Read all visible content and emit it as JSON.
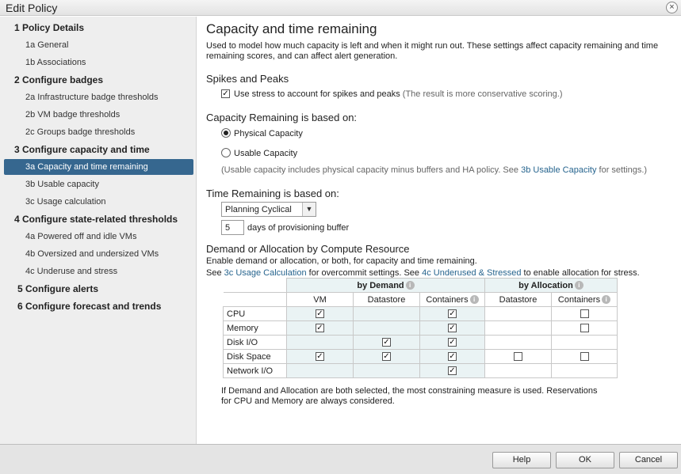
{
  "window": {
    "title": "Edit Policy",
    "close_glyph": "×"
  },
  "sidebar": {
    "items": [
      {
        "label": "1 Policy Details",
        "level": "h"
      },
      {
        "label": "1a General",
        "level": "s"
      },
      {
        "label": "1b Associations",
        "level": "s"
      },
      {
        "label": "2 Configure badges",
        "level": "h"
      },
      {
        "label": "2a Infrastructure badge thresholds",
        "level": "s"
      },
      {
        "label": "2b VM badge thresholds",
        "level": "s"
      },
      {
        "label": "2c Groups badge thresholds",
        "level": "s"
      },
      {
        "label": "3 Configure capacity and time",
        "level": "h"
      },
      {
        "label": "3a Capacity and time remaining",
        "level": "s",
        "selected": true
      },
      {
        "label": "3b Usable capacity",
        "level": "s"
      },
      {
        "label": "3c Usage calculation",
        "level": "s"
      },
      {
        "label": "4 Configure state-related thresholds",
        "level": "h"
      },
      {
        "label": "4a Powered off and idle VMs",
        "level": "s"
      },
      {
        "label": "4b Oversized and undersized VMs",
        "level": "s"
      },
      {
        "label": "4c Underuse and stress",
        "level": "s"
      },
      {
        "label": "5 Configure alerts",
        "level": "h"
      },
      {
        "label": "6 Configure forecast and trends",
        "level": "h"
      }
    ]
  },
  "main": {
    "title": "Capacity and time remaining",
    "intro_line1": "Used to model how much capacity is left and when it might run out. These settings affect capacity remaining and time",
    "intro_line2": "remaining scores, and can affect alert generation.",
    "spikes": {
      "heading": "Spikes and Peaks",
      "checkbox_label": "Use stress to account for spikes and peaks",
      "checked": true,
      "note": "(The result is more conservative scoring.)"
    },
    "capacity": {
      "heading": "Capacity Remaining is based on:",
      "option_physical": "Physical Capacity",
      "option_usable": "Usable Capacity",
      "selected": "Physical Capacity",
      "note_prefix": "(Usable capacity includes physical capacity minus buffers and HA policy. See",
      "note_link": "3b Usable Capacity",
      "note_suffix": "for settings.)"
    },
    "time": {
      "heading": "Time Remaining is based on:",
      "select_value": "Planning Cyclical",
      "days_value": "5",
      "days_label": "days of provisioning buffer"
    },
    "demand": {
      "heading": "Demand or Allocation by Compute Resource",
      "desc": "Enable demand or allocation, or both, for capacity and time remaining.",
      "see": "See",
      "link1": "3c Usage Calculation",
      "mid": "for overcommit settings. See",
      "link2": "4c Underused & Stressed",
      "end": "to enable allocation for stress.",
      "group_demand": "by Demand",
      "group_allocation": "by Allocation",
      "columns": [
        "VM",
        "Datastore",
        "Containers",
        "Datastore",
        "Containers"
      ],
      "rows": [
        {
          "label": "CPU",
          "cells": [
            "on",
            "none",
            "on",
            "none",
            "off"
          ]
        },
        {
          "label": "Memory",
          "cells": [
            "on",
            "none",
            "on",
            "none",
            "off"
          ]
        },
        {
          "label": "Disk I/O",
          "cells": [
            "none",
            "on",
            "on",
            "none",
            "none"
          ]
        },
        {
          "label": "Disk Space",
          "cells": [
            "on",
            "on",
            "on",
            "off",
            "off"
          ]
        },
        {
          "label": "Network I/O",
          "cells": [
            "none",
            "none",
            "on",
            "none",
            "none"
          ]
        }
      ],
      "footnote_line1": "If Demand and Allocation are both selected, the most constraining measure is used. Reservations",
      "footnote_line2": "for CPU and Memory are always considered."
    }
  },
  "footer": {
    "help": "Help",
    "ok": "OK",
    "cancel": "Cancel"
  },
  "icons": {
    "info_glyph": "i",
    "check_glyph": "✓",
    "dropdown_glyph": "▼"
  }
}
